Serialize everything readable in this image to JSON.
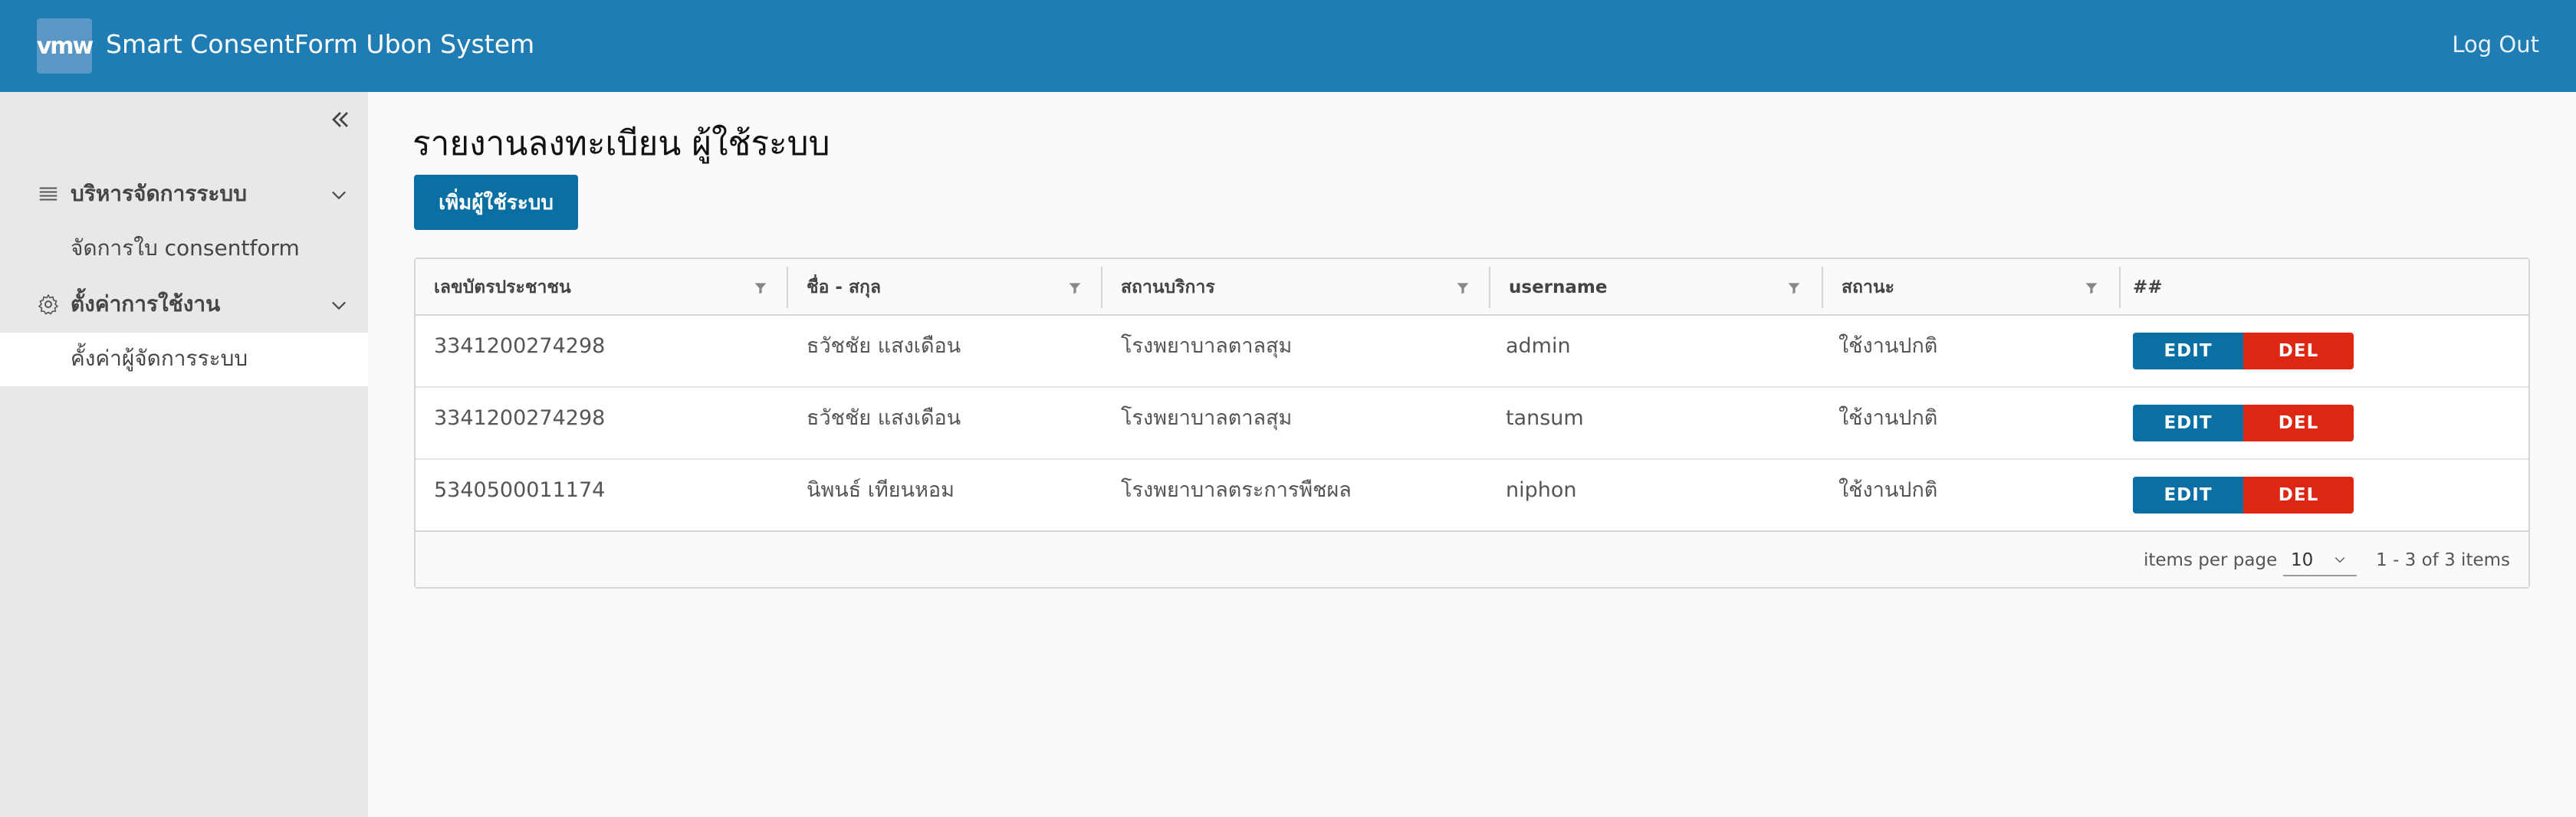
{
  "header": {
    "logo_text": "vmw",
    "app_title": "Smart ConsentForm Ubon System",
    "logout_label": "Log Out"
  },
  "sidebar": {
    "groups": [
      {
        "label": "บริหารจัดการระบบ",
        "icon": "list-icon",
        "items": [
          {
            "label": "จัดการใบ consentform"
          }
        ]
      },
      {
        "label": "ตั้งค่าการใช้งาน",
        "icon": "gear-icon",
        "items": [
          {
            "label": "คั้งค่าผู้จัดการระบบ",
            "active": true
          }
        ]
      }
    ]
  },
  "main": {
    "page_title": "รายงานลงทะเบียน ผู้ใช้ระบบ",
    "add_button": "เพิ่มผู้ใช้ระบบ",
    "columns": [
      "เลขบัตรประชาชน",
      "ชื่อ - สกุล",
      "สถานบริการ",
      "username",
      "สถานะ",
      "##"
    ],
    "rows": [
      {
        "cid": "3341200274298",
        "name": "ธวัชชัย แสงเดือน",
        "hospital": "โรงพยาบาลตาลสุม",
        "username": "admin",
        "status": "ใช้งานปกติ"
      },
      {
        "cid": "3341200274298",
        "name": "ธวัชชัย แสงเดือน",
        "hospital": "โรงพยาบาลตาลสุม",
        "username": "tansum",
        "status": "ใช้งานปกติ"
      },
      {
        "cid": "5340500011174",
        "name": "นิพนธ์ เทียนหอม",
        "hospital": "โรงพยาบาลตระการพืชผล",
        "username": "niphon",
        "status": "ใช้งานปกติ"
      }
    ],
    "edit_label": "EDIT",
    "del_label": "DEL",
    "footer": {
      "items_per_page_label": "items per page",
      "items_per_page_value": "10",
      "pager_text": "1 - 3 of 3 items"
    }
  },
  "colors": {
    "header_bg": "#1f7db4",
    "primary": "#0a6fa3",
    "danger": "#dd2712",
    "sidebar_bg": "#e8e8e8"
  }
}
